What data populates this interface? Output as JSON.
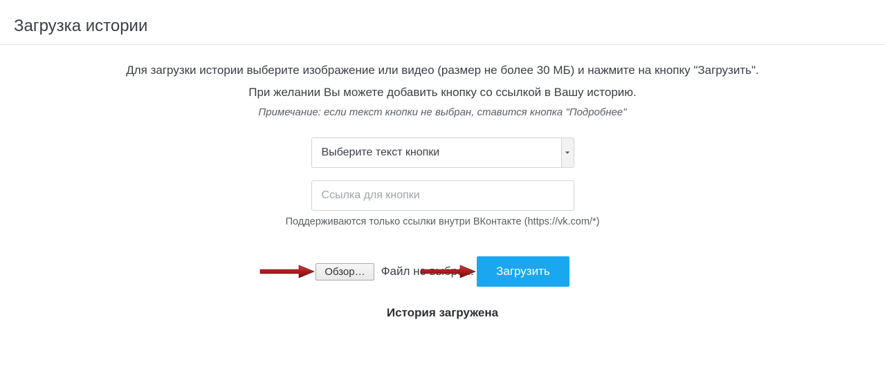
{
  "header": {
    "title": "Загрузка истории"
  },
  "intro": {
    "line1": "Для загрузки истории выберите изображение или видео (размер не более 30 МБ) и нажмите на кнопку \"Загрузить\".",
    "line2": "При желании Вы можете добавить кнопку со ссылкой в Вашу историю.",
    "note": "Примечание: если текст кнопки не выбран, ставится кнопка \"Подробнее\""
  },
  "form": {
    "button_text_select": {
      "placeholder": "Выберите текст кнопки"
    },
    "link_input": {
      "placeholder": "Ссылка для кнопки",
      "value": ""
    },
    "link_hint": "Поддерживаются только ссылки внутри ВКонтакте (https://vk.com/*)",
    "file": {
      "browse_label": "Обзор…",
      "status": "Файл не выбран."
    },
    "submit_label": "Загрузить"
  },
  "result": {
    "status": "История загружена"
  }
}
